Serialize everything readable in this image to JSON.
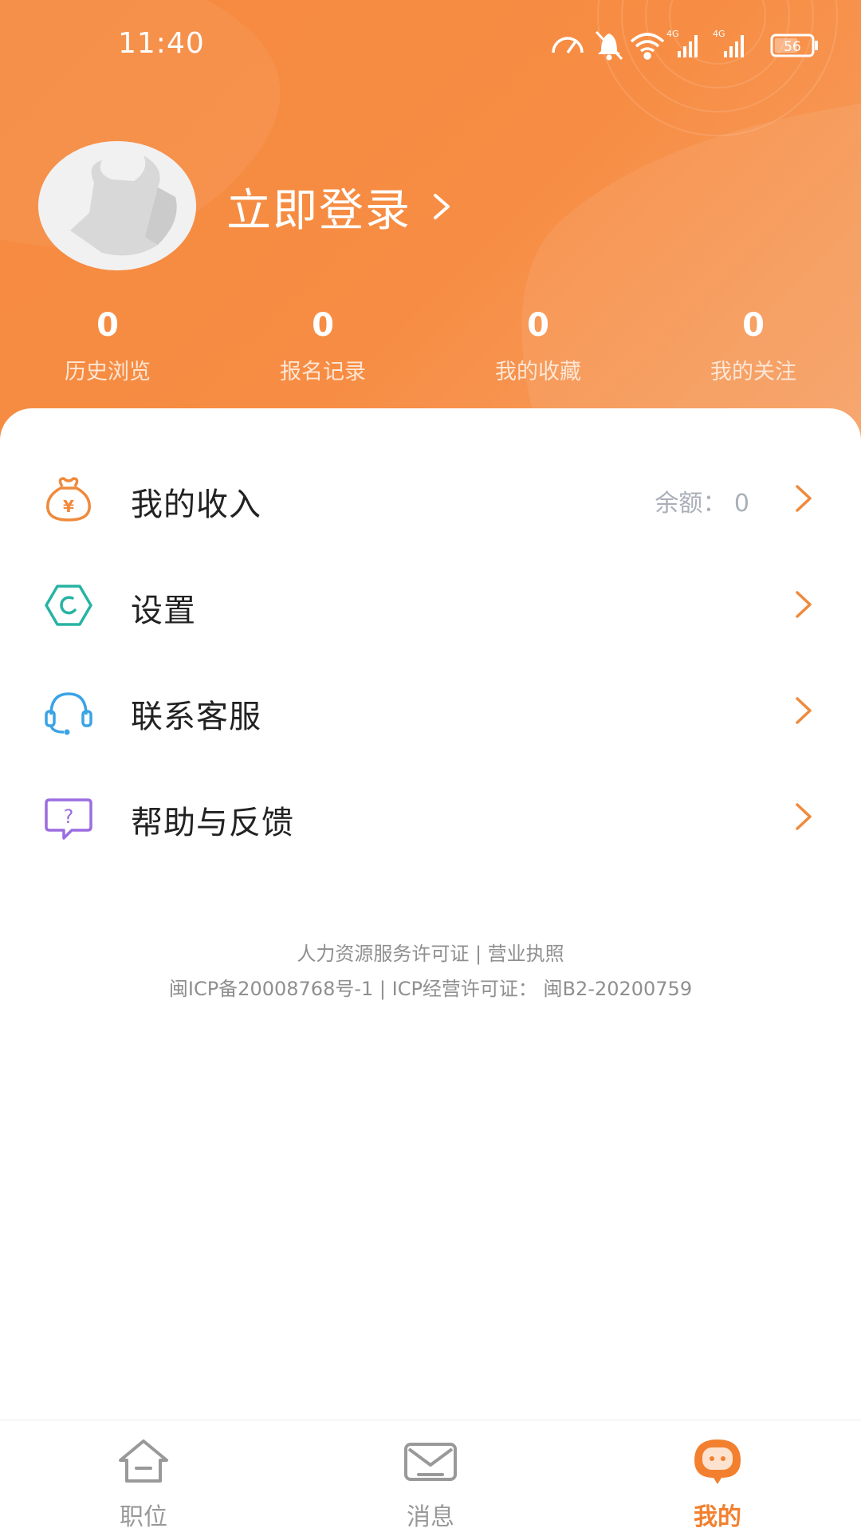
{
  "status_bar": {
    "time": "11:40",
    "battery": "56",
    "network_1": "4G",
    "network_2": "4G",
    "icons": [
      "speed-icon",
      "bell-muted-icon",
      "wifi-icon",
      "signal-icon",
      "signal-icon",
      "battery-icon"
    ]
  },
  "profile": {
    "login_label": "立即登录",
    "avatar_icon": "bull-avatar-icon"
  },
  "stats": [
    {
      "value": "0",
      "label": "历史浏览"
    },
    {
      "value": "0",
      "label": "报名记录"
    },
    {
      "value": "0",
      "label": "我的收藏"
    },
    {
      "value": "0",
      "label": "我的关注"
    }
  ],
  "menu": [
    {
      "label": "我的收入",
      "extra": "余额：  0",
      "icon": "money-bag-icon",
      "icon_color": "#ef8a3c"
    },
    {
      "label": "设置",
      "extra": "",
      "icon": "settings-icon",
      "icon_color": "#27b3a4"
    },
    {
      "label": "联系客服",
      "extra": "",
      "icon": "headset-icon",
      "icon_color": "#3aa3e6"
    },
    {
      "label": "帮助与反馈",
      "extra": "",
      "icon": "help-chat-icon",
      "icon_color": "#9b6de0"
    }
  ],
  "footer": {
    "line1": "人力资源服务许可证 | 营业执照",
    "line2": "闽ICP备20008768号-1 | ICP经营许可证：  闽B2-20200759"
  },
  "tabs": [
    {
      "label": "职位",
      "icon": "home-icon",
      "active": false
    },
    {
      "label": "消息",
      "icon": "mail-icon",
      "active": false
    },
    {
      "label": "我的",
      "icon": "mascot-icon",
      "active": true
    }
  ],
  "colors": {
    "accent": "#f2802f",
    "header_gradient_start": "#f58a3f",
    "header_gradient_end": "#f6a064",
    "arrow": "#ef8a3c"
  }
}
